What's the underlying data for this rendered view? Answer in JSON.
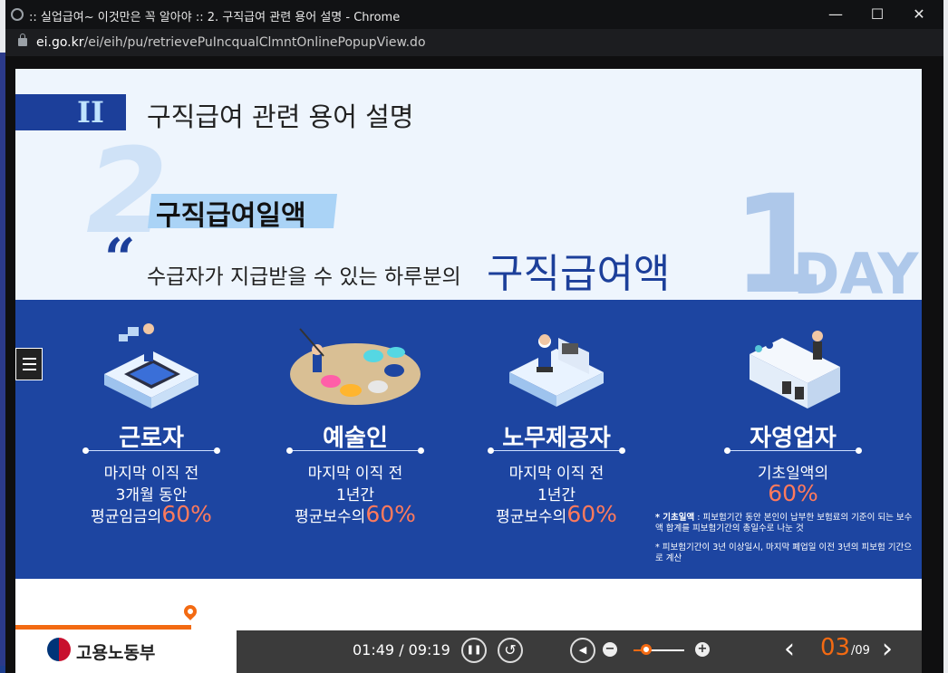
{
  "window": {
    "title": ":: 실업급여~ 이것만은 꼭 알아야 :: 2. 구직급여 관련 용어 설명 - Chrome",
    "minimize_glyph": "—",
    "maximize_glyph": "☐",
    "close_glyph": "✕"
  },
  "address_bar": {
    "domain": "ei.go.kr",
    "path": "/ei/eih/pu/retrievePuIncqualClmntOnlinePopupView.do"
  },
  "slide": {
    "section_number": "II",
    "section_title": "구직급여 관련 용어 설명",
    "item_number": "2",
    "term": "구직급여일액",
    "quote_mark": "“",
    "description": "수급자가 지급받을 수 있는 하루분의",
    "description_emphasis": "구직급여액",
    "day_number": "1",
    "day_text": "DAY",
    "columns": [
      {
        "role": "근로자",
        "line1": "마지막 이직 전",
        "line2": "3개월 동안",
        "line3": "평균임금의",
        "pct": "60%"
      },
      {
        "role": "예술인",
        "line1": "마지막 이직 전",
        "line2": "1년간",
        "line3": "평균보수의",
        "pct": "60%"
      },
      {
        "role": "노무제공자",
        "line1": "마지막 이직 전",
        "line2": "1년간",
        "line3": "평균보수의",
        "pct": "60%"
      },
      {
        "role": "자영업자",
        "line1": "기초일액의",
        "pct": "60%"
      }
    ],
    "note1_label": "* 기초일액",
    "note1_text": ": 피보험기간 동안 본인이 납부한 보험료의 기준이 되는 보수액 합계를 피보험기간의 총일수로 나눈 것",
    "note2_text": "* 피보험기간이 3년 이상일시, 마지막 폐업일 이전 3년의 피보험 기간으로 계산"
  },
  "footer": {
    "logo_text": "고용노동부",
    "time": "01:49 / 09:19",
    "page_current": "03",
    "page_total": "/09",
    "volume_level": 0.25,
    "pause_glyph": "❚❚",
    "replay_glyph": "↺",
    "volume_glyph": "◀",
    "minus_glyph": "−",
    "plus_glyph": "+",
    "prev_glyph": "‹",
    "next_glyph": "›"
  },
  "colors": {
    "brand_blue": "#1d45a1",
    "accent_orange": "#f36a12",
    "pct_color": "#ff7a5c"
  }
}
